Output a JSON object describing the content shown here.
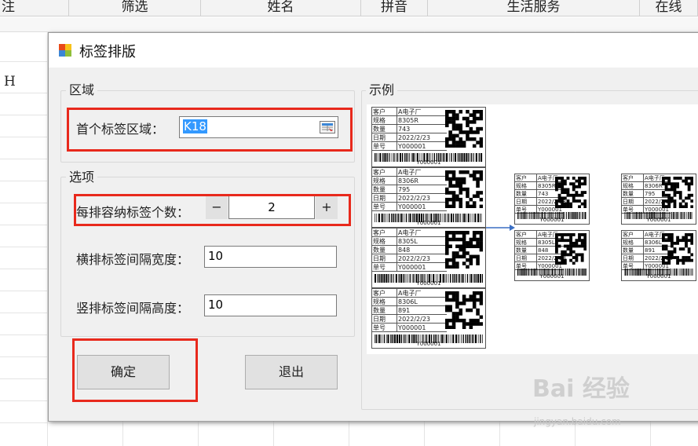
{
  "sheet": {
    "columns": [
      "注",
      "筛选",
      "姓名",
      "拼音",
      "生活服务",
      "在线"
    ],
    "row_label": "H"
  },
  "dialog": {
    "title": "标签排版",
    "area_group": {
      "title": "区域",
      "first_label_area_label": "首个标签区域：",
      "first_label_area_value": "K18"
    },
    "options_group": {
      "title": "选项",
      "per_row_label": "每排容纳标签个数：",
      "per_row_value": "2",
      "minus_label": "−",
      "plus_label": "+",
      "h_spacing_label": "横排标签间隔宽度：",
      "h_spacing_value": "10",
      "v_spacing_label": "竖排标签间隔高度：",
      "v_spacing_value": "10"
    },
    "ok_label": "确定",
    "exit_label": "退出",
    "example_group": {
      "title": "示例"
    }
  },
  "label_cards": [
    {
      "customer": "A电子厂",
      "spec": "8305R",
      "qty": "743",
      "date": "2022/2/23",
      "order": "Y000001",
      "code": "Y000001"
    },
    {
      "customer": "A电子厂",
      "spec": "8306R",
      "qty": "795",
      "date": "2022/2/23",
      "order": "Y000001",
      "code": "Y000001"
    },
    {
      "customer": "A电子厂",
      "spec": "8305L",
      "qty": "848",
      "date": "2022/2/23",
      "order": "Y000001",
      "code": "Y000001"
    },
    {
      "customer": "A电子厂",
      "spec": "8306L",
      "qty": "891",
      "date": "2022/2/23",
      "order": "Y000001",
      "code": "Y000001"
    }
  ],
  "card_keys": {
    "customer": "客户",
    "spec": "规格",
    "qty": "数量",
    "date": "日期",
    "order": "单号"
  },
  "watermark": {
    "text": "Bai 经验",
    "sub": "jingyan.baidu.com"
  },
  "colors": {
    "highlight": "#e8291c",
    "arrow": "#3a6fc4",
    "selection": "#3399ff"
  }
}
